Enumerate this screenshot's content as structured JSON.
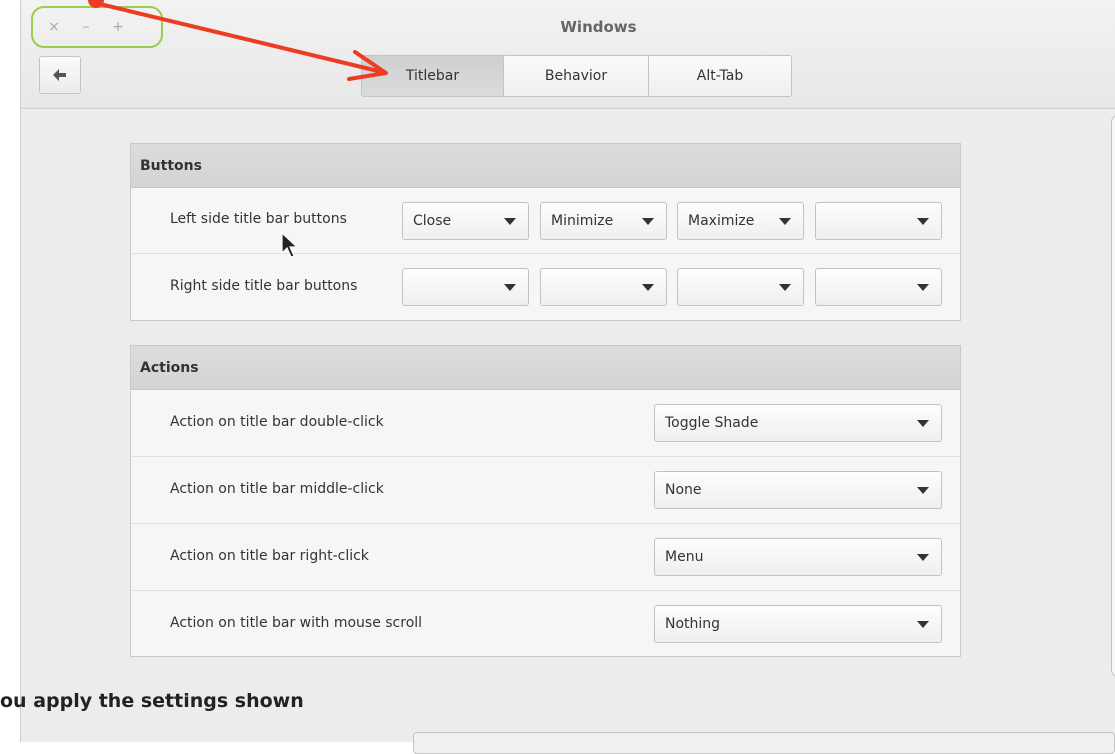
{
  "window": {
    "title": "Windows"
  },
  "wm_buttons": {
    "close": "×",
    "minimize": "–",
    "maximize": "+"
  },
  "tabs": [
    {
      "label": "Titlebar",
      "active": true
    },
    {
      "label": "Behavior",
      "active": false
    },
    {
      "label": "Alt-Tab",
      "active": false
    }
  ],
  "buttons_section": {
    "title": "Buttons",
    "left_label": "Left side title bar buttons",
    "left_values": [
      "Close",
      "Minimize",
      "Maximize",
      ""
    ],
    "right_label": "Right side title bar buttons",
    "right_values": [
      "",
      "",
      "",
      ""
    ]
  },
  "actions_section": {
    "title": "Actions",
    "rows": [
      {
        "label": "Action on title bar double-click",
        "value": "Toggle Shade"
      },
      {
        "label": "Action on title bar middle-click",
        "value": "None"
      },
      {
        "label": "Action on title bar right-click",
        "value": "Menu"
      },
      {
        "label": "Action on title bar with mouse scroll",
        "value": "Nothing"
      }
    ]
  },
  "caption": "ou apply the settings shown",
  "colors": {
    "annotation_arrow": "#ee3b24",
    "highlight_outline": "#9ccc4f"
  },
  "icons": {
    "back": "back-arrow-icon",
    "combo_arrow": "dropdown-arrow-icon"
  }
}
